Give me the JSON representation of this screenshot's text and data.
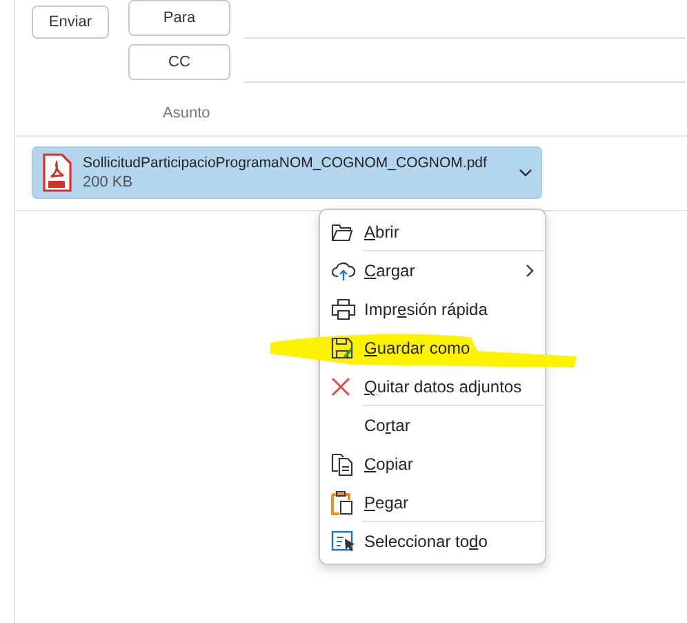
{
  "header": {
    "send_button": "Enviar",
    "to_button": "Para",
    "cc_button": "CC",
    "subject_label": "Asunto"
  },
  "attachment": {
    "name": "SollicitudParticipacioProgramaNOM_COGNOM_COGNOM.pdf",
    "size": "200 KB",
    "selected": true
  },
  "context_menu": {
    "items": [
      {
        "kind": "open",
        "key": "A",
        "post": "brir",
        "submenu": false,
        "separator_after": true
      },
      {
        "kind": "upload",
        "key": "C",
        "post": "argar",
        "submenu": true,
        "separator_after": false
      },
      {
        "kind": "print",
        "pre": "Impr",
        "key": "e",
        "post": "sión rápida",
        "submenu": false,
        "separator_after": false
      },
      {
        "kind": "save",
        "key": "G",
        "post": "uardar como",
        "submenu": false,
        "separator_after": false,
        "highlighted": true
      },
      {
        "kind": "remove",
        "key": "Q",
        "post": "uitar datos adjuntos",
        "submenu": false,
        "separator_after": true
      },
      {
        "kind": "cut",
        "pre": "Co",
        "key": "r",
        "post": "tar",
        "submenu": false,
        "separator_after": false
      },
      {
        "kind": "copy",
        "key": "C",
        "post": "opiar",
        "submenu": false,
        "separator_after": false
      },
      {
        "kind": "paste",
        "key": "P",
        "post": "egar",
        "submenu": false,
        "separator_after": true
      },
      {
        "kind": "select_all",
        "pre": "Seleccionar to",
        "key": "d",
        "post": "o",
        "submenu": false,
        "separator_after": false
      }
    ]
  }
}
